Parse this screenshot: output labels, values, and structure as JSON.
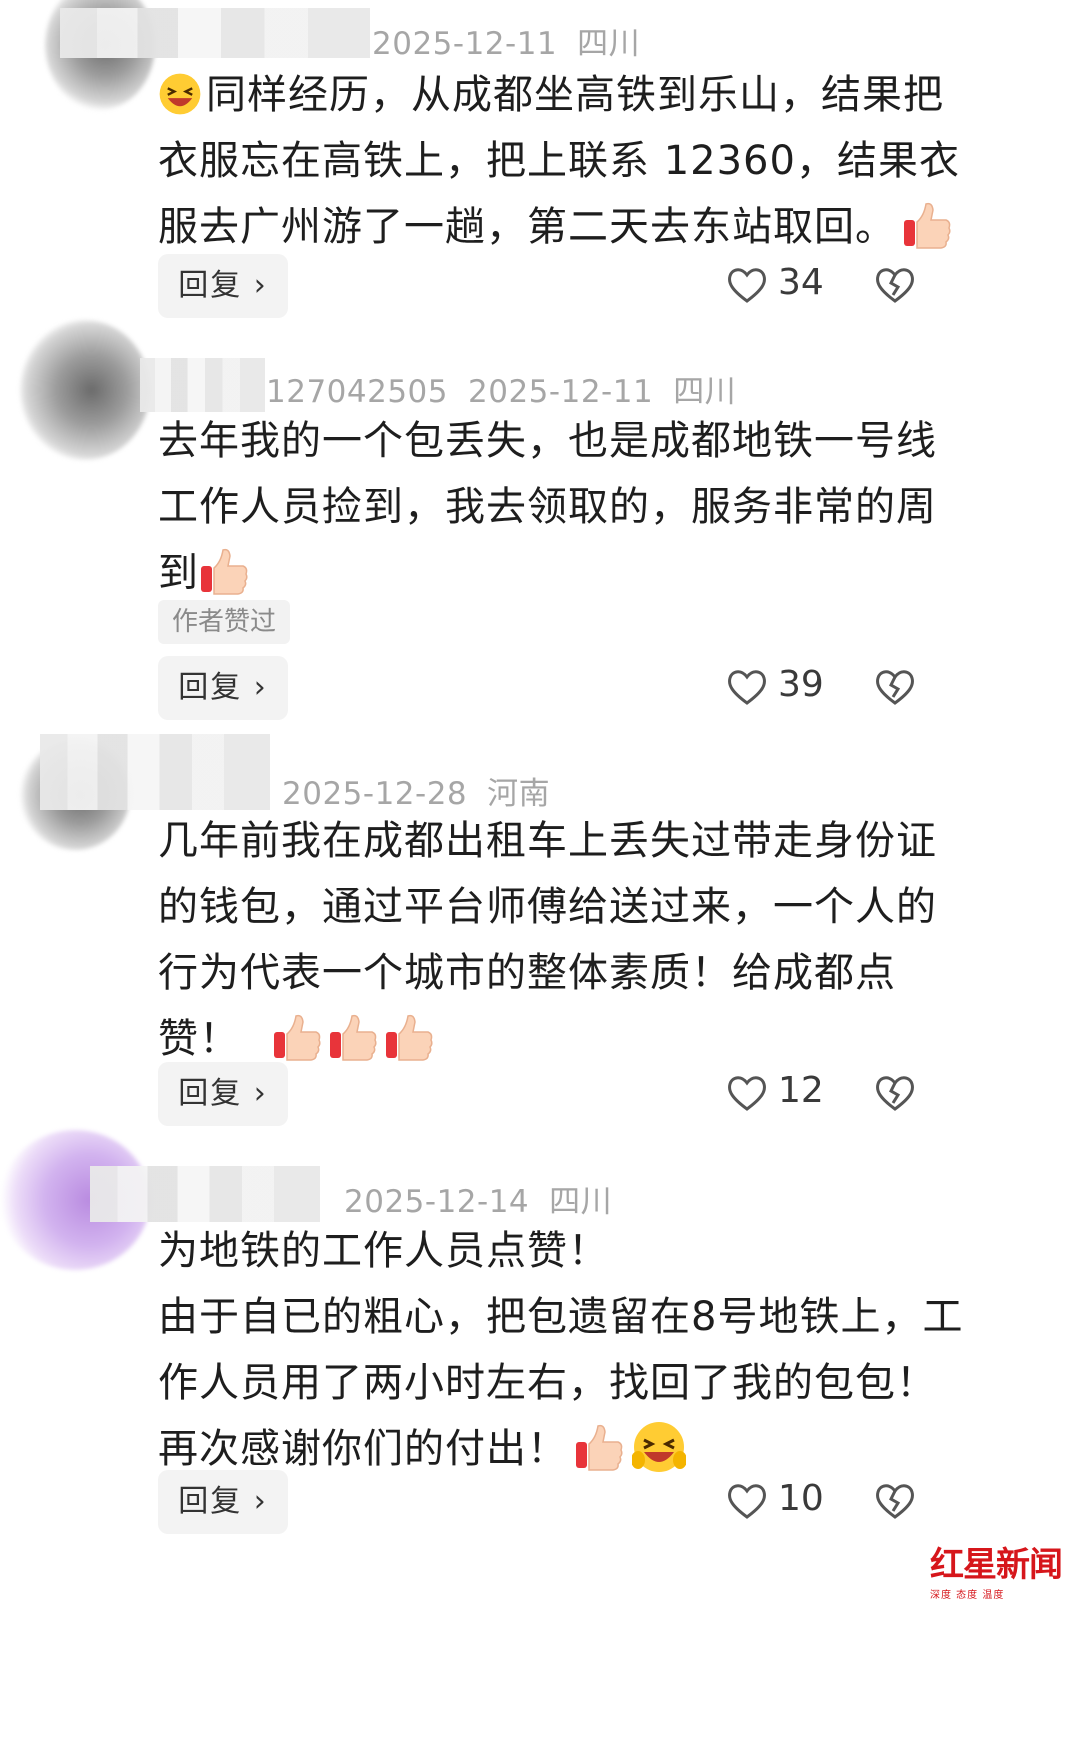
{
  "comments": [
    {
      "id_suffix": "",
      "date": "2025-12-11",
      "location": "四川",
      "lines": [
        "同样经历，从成都坐高铁到乐山，结果把",
        "衣服忘在高铁上，把上联系 12360，结果衣",
        "服去广州游了一趟，第二天去东站取回。"
      ],
      "reply_label": "回复",
      "likes": "34"
    },
    {
      "id_suffix": "127042505",
      "date": "2025-12-11",
      "location": "四川",
      "lines": [
        "去年我的一个包丢失，也是成都地铁一号线",
        "工作人员捡到，我去领取的，服务非常的周",
        "到"
      ],
      "tag": "作者赞过",
      "reply_label": "回复",
      "likes": "39"
    },
    {
      "id_suffix": "",
      "date": "2025-12-28",
      "location": "河南",
      "lines": [
        "几年前我在成都出租车上丢失过带走身份证",
        "的钱包，通过平台师傅给送过来，一个人的",
        "行为代表一个城市的整体素质！给成都点",
        "赞！"
      ],
      "reply_label": "回复",
      "likes": "12"
    },
    {
      "id_suffix": "",
      "date": "2025-12-14",
      "location": "四川",
      "lines": [
        "为地铁的工作人员点赞！",
        "由于自已的粗心，把包遗留在8号地铁上，工",
        "作人员用了两小时左右，找回了我的包包！",
        "再次感谢你们的付出！"
      ],
      "reply_label": "回复",
      "likes": "10"
    }
  ],
  "icons": {
    "like": "heart-outline-icon",
    "dislike": "broken-heart-icon",
    "thumb": "thumbs-up-emoji",
    "laugh": "laughing-emoji",
    "reply_chevron": "chevron-right-icon"
  },
  "watermark": {
    "title": "红星新闻",
    "subtitle": "深度 态度 温度"
  }
}
